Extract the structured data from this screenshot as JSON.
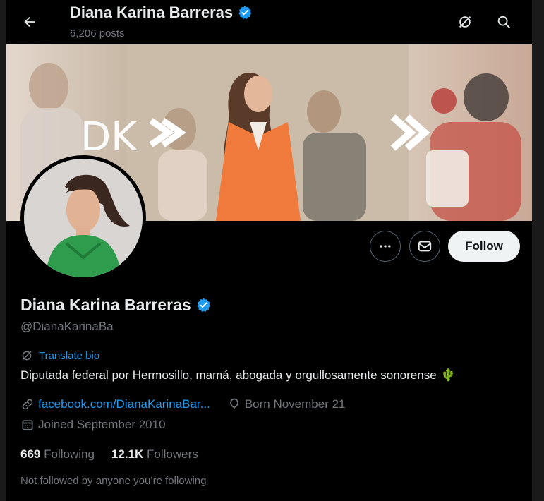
{
  "header": {
    "title": "Diana Karina Barreras",
    "posts": "6,206 posts"
  },
  "banner": {
    "logo_text": "DK"
  },
  "profile": {
    "name": "Diana Karina Barreras",
    "handle": "@DianaKarinaBa",
    "translate_label": "Translate bio",
    "bio": "Diputada federal por Hermosillo, mamá, abogada y orgullosamente sonorense",
    "bio_emoji": "🌵",
    "link": "facebook.com/DianaKarinaBar...",
    "birthday": "Born November 21",
    "joined": "Joined September 2010",
    "following_count": "669",
    "following_label": "Following",
    "followers_count": "12.1K",
    "followers_label": "Followers",
    "not_followed": "Not followed by anyone you’re following"
  },
  "buttons": {
    "follow": "Follow"
  },
  "colors": {
    "accent": "#1d9bf0",
    "verified": "#1d9bf0",
    "follow_bg": "#eff3f4",
    "banner_orange": "#f07a3c"
  },
  "icons": [
    "back-arrow-icon",
    "grok-icon",
    "search-icon",
    "more-icon",
    "mail-icon",
    "verified-icon",
    "link-icon",
    "balloon-icon",
    "calendar-icon"
  ]
}
